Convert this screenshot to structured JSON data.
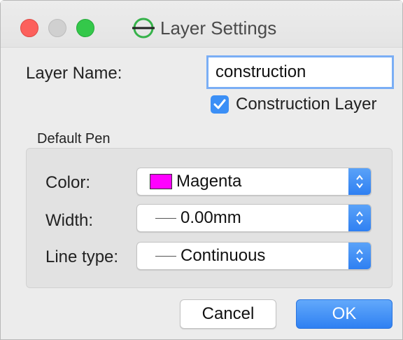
{
  "window": {
    "title": "Layer Settings"
  },
  "form": {
    "layer_name_label": "Layer Name:",
    "layer_name_value": "construction",
    "construction_layer_label": "Construction Layer",
    "construction_layer_checked": true
  },
  "default_pen": {
    "group_title": "Default Pen",
    "color_label": "Color:",
    "color_value": "Magenta",
    "color_hex": "#ff00ff",
    "width_label": "Width:",
    "width_value": "0.00mm",
    "line_type_label": "Line type:",
    "line_type_value": "Continuous"
  },
  "buttons": {
    "cancel_label": "Cancel",
    "ok_label": "OK"
  },
  "colors": {
    "accent": "#2f80f2",
    "window_bg": "#ececec"
  }
}
